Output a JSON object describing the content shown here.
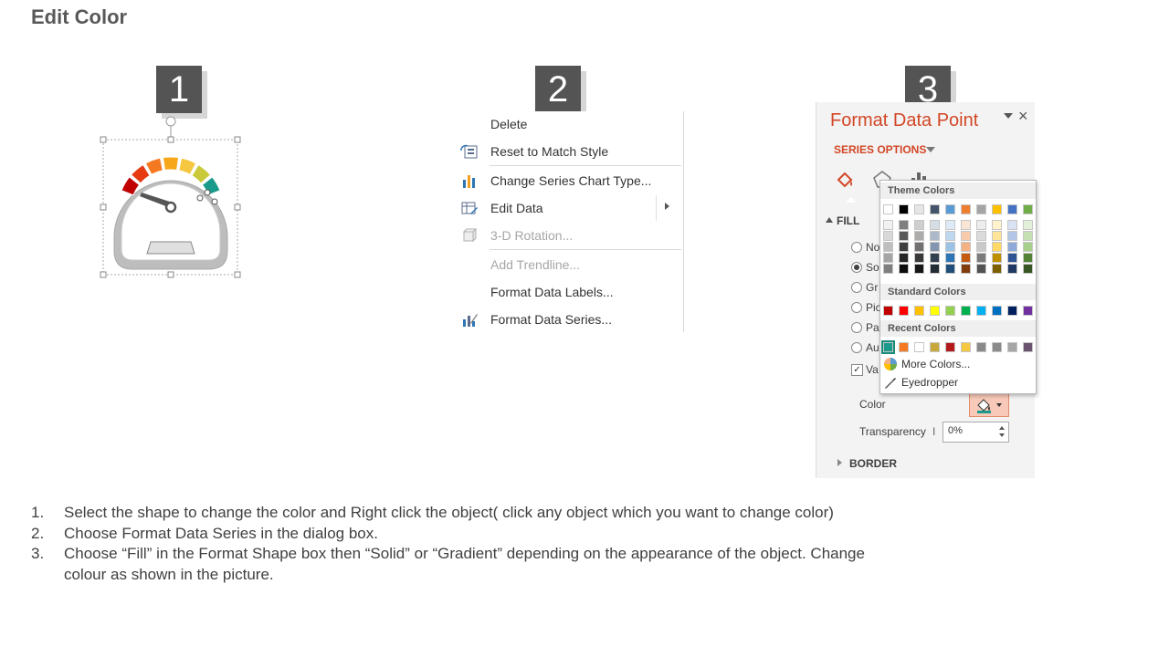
{
  "page_title": "Edit Color",
  "steps": [
    "1",
    "2",
    "3"
  ],
  "context_menu": {
    "items": [
      {
        "label": "Delete",
        "icon": "none",
        "disabled": false
      },
      {
        "label": "Reset to Match Style",
        "icon": "reset-style-icon",
        "disabled": false
      },
      {
        "label": "Change Series Chart Type...",
        "icon": "bar-chart-icon",
        "disabled": false
      },
      {
        "label": "Edit Data",
        "icon": "edit-data-icon",
        "disabled": false,
        "submenu": true
      },
      {
        "label": "3-D Rotation...",
        "icon": "rotation-3d-icon",
        "disabled": true
      },
      {
        "label": "Add Trendline...",
        "icon": "none",
        "disabled": true
      },
      {
        "label": "Format Data Labels...",
        "icon": "none",
        "disabled": false
      },
      {
        "label": "Format Data Series...",
        "icon": "format-series-icon",
        "disabled": false
      }
    ]
  },
  "format_pane": {
    "title": "Format Data Point",
    "close_glyph": "×",
    "series_options": "SERIES OPTIONS",
    "fill_header": "FILL",
    "fill_options": [
      "No",
      "So",
      "Gr",
      "Pic",
      "Pa",
      "Au"
    ],
    "selected_fill_index": 1,
    "vary_label": "Va",
    "color_label": "Color",
    "transparency_label": "Transparency",
    "transparency_tick": "I",
    "transparency_value": "0%",
    "border_label": "BORDER",
    "accent_color": "#d24726"
  },
  "color_picker": {
    "theme_header": "Theme Colors",
    "standard_header": "Standard Colors",
    "recent_header": "Recent Colors",
    "more_colors": "More Colors...",
    "eyedropper": "Eyedropper",
    "theme_top": [
      "#ffffff",
      "#000000",
      "#e7e6e6",
      "#44546a",
      "#5b9bd5",
      "#ed7d31",
      "#a5a5a5",
      "#ffc000",
      "#4472c4",
      "#70ad47"
    ],
    "theme_shades": [
      [
        "#f2f2f2",
        "#7f7f7f",
        "#d0cece",
        "#d6dce4",
        "#deebf6",
        "#fbe5d5",
        "#ededed",
        "#fff2cc",
        "#d9e2f3",
        "#e2efd9"
      ],
      [
        "#d8d8d8",
        "#595959",
        "#aeabab",
        "#adb9ca",
        "#bdd7ee",
        "#f7cbac",
        "#dbdbdb",
        "#fee599",
        "#b4c6e7",
        "#c5e0b3"
      ],
      [
        "#bfbfbf",
        "#3f3f3f",
        "#757070",
        "#8496b0",
        "#9cc3e5",
        "#f4b183",
        "#c9c9c9",
        "#ffd965",
        "#8eaadb",
        "#a8d08d"
      ],
      [
        "#a5a5a5",
        "#262626",
        "#3a3838",
        "#323f4f",
        "#2e75b5",
        "#c55a11",
        "#7b7b7b",
        "#bf9000",
        "#2f5496",
        "#538135"
      ],
      [
        "#7f7f7f",
        "#0c0c0c",
        "#171616",
        "#222a35",
        "#1e4e79",
        "#833c0b",
        "#525252",
        "#7f6000",
        "#1f3864",
        "#375623"
      ]
    ],
    "standard": [
      "#c00000",
      "#ff0000",
      "#ffc000",
      "#ffff00",
      "#92d050",
      "#00b050",
      "#00b0f0",
      "#0070c0",
      "#002060",
      "#7030a0"
    ],
    "recent": [
      "#1a9a8a",
      "#f47920",
      "#ffffff",
      "#c9a83a",
      "#b31b1b",
      "#f6c842",
      "#8a8a8a",
      "#8a8a8a",
      "#a6a6a6",
      "#6b5470"
    ],
    "selected_recent_index": 0
  },
  "gauge": {
    "segment_colors": [
      "#c00000",
      "#e53a12",
      "#f47920",
      "#f6a71a",
      "#f6c842",
      "#c9c93a",
      "#1a9a8a"
    ]
  },
  "instructions": [
    {
      "num": "1.",
      "text": "Select the shape to change the color and Right click the object( click any object which you want to change color)"
    },
    {
      "num": "2.",
      "text": "Choose Format Data Series in the dialog box."
    },
    {
      "num": "3.",
      "text": "Choose “Fill” in the Format Shape box then “Solid” or “Gradient” depending on the appearance of the object. Change colour as shown in the picture."
    }
  ]
}
